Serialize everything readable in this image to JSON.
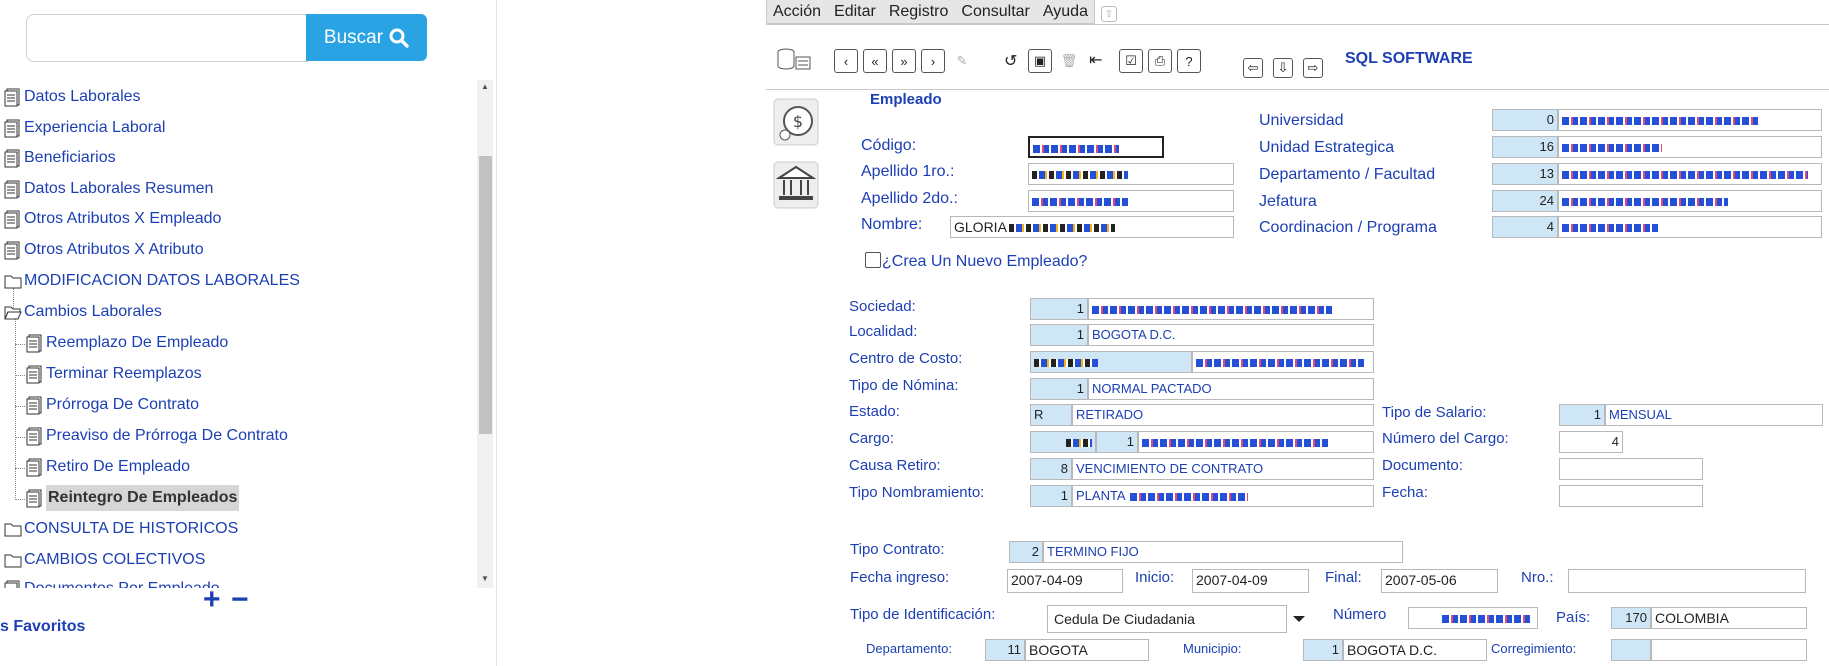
{
  "search": {
    "placeholder": "",
    "button_label": "Buscar"
  },
  "tree": {
    "items": [
      {
        "label": "Datos Laborales"
      },
      {
        "label": "Experiencia Laboral"
      },
      {
        "label": "Beneficiarios"
      },
      {
        "label": "Datos Laborales Resumen"
      },
      {
        "label": "Otros Atributos X Empleado"
      },
      {
        "label": "Otros Atributos X Atributo"
      },
      {
        "label": "MODIFICACION DATOS LABORALES"
      },
      {
        "label": "Cambios Laborales"
      },
      {
        "label": "Reemplazo De Empleado"
      },
      {
        "label": "Terminar Reemplazos"
      },
      {
        "label": "Prórroga De Contrato"
      },
      {
        "label": "Preaviso de Prórroga De Contrato"
      },
      {
        "label": "Retiro De Empleado"
      },
      {
        "label": "Reintegro De Empleados"
      },
      {
        "label": "CONSULTA DE HISTORICOS"
      },
      {
        "label": "CAMBIOS COLECTIVOS"
      },
      {
        "label": "Documentos Por Empleado"
      }
    ],
    "zoom_in": "+",
    "zoom_out": "−",
    "favoritos": "s Favoritos"
  },
  "menu": {
    "items": [
      "Acción",
      "Editar",
      "Registro",
      "Consultar",
      "Ayuda"
    ]
  },
  "toolbar": {
    "brand": "SQL SOFTWARE"
  },
  "empleado": {
    "section_title": "Empleado",
    "codigo_label": "Código:",
    "apellido1_label": "Apellido 1ro.:",
    "apellido2_label": "Apellido 2do.:",
    "nombre_label": "Nombre:",
    "nombre_value": "GLORIA",
    "nuevo_label": "¿Crea Un Nuevo Empleado?"
  },
  "org": {
    "universidad_label": "Universidad",
    "universidad_code": "0",
    "unidad_label": "Unidad Estrategica",
    "unidad_code": "16",
    "departamento_label": "Departamento / Facultad",
    "departamento_code": "13",
    "jefatura_label": "Jefatura",
    "jefatura_code": "24",
    "coordinacion_label": "Coordinacion / Programa",
    "coordinacion_code": "4"
  },
  "laboral": {
    "sociedad_label": "Sociedad:",
    "sociedad_code": "1",
    "localidad_label": "Localidad:",
    "localidad_code": "1",
    "localidad_value": "BOGOTA D.C.",
    "centro_label": "Centro de Costo:",
    "tipo_nomina_label": "Tipo de Nómina:",
    "tipo_nomina_code": "1",
    "tipo_nomina_value": "NORMAL PACTADO",
    "estado_label": "Estado:",
    "estado_code": "R",
    "estado_value": "RETIRADO",
    "cargo_label": "Cargo:",
    "cargo_code2": "1",
    "causa_label": "Causa Retiro:",
    "causa_code": "8",
    "causa_value": "VENCIMIENTO DE CONTRATO",
    "nombramiento_label": "Tipo Nombramiento:",
    "nombramiento_code": "1",
    "nombramiento_value": "PLANTA",
    "tipo_salario_label": "Tipo de Salario:",
    "tipo_salario_code": "1",
    "tipo_salario_value": "MENSUAL",
    "numero_cargo_label": "Número del Cargo:",
    "numero_cargo_value": "4",
    "documento_label": "Documento:",
    "fecha_label": "Fecha:"
  },
  "contrato": {
    "tipo_label": "Tipo Contrato:",
    "tipo_code": "2",
    "tipo_value": "TERMINO FIJO",
    "ingreso_label": "Fecha ingreso:",
    "ingreso_value": "2007-04-09",
    "inicio_label": "Inicio:",
    "inicio_value": "2007-04-09",
    "final_label": "Final:",
    "final_value": "2007-05-06",
    "nro_label": "Nro.:"
  },
  "identificacion": {
    "tipo_label": "Tipo de Identificación:",
    "tipo_value": "Cedula De Ciudadania",
    "numero_label": "Número",
    "pais_label": "País:",
    "pais_code": "170",
    "pais_value": "COLOMBIA",
    "departamento_label": "Departamento:",
    "departamento_code": "11",
    "departamento_value": "BOGOTA",
    "municipio_label": "Municipio:",
    "municipio_code": "1",
    "municipio_value": "BOGOTA D.C.",
    "corregimiento_label": "Corregimiento:"
  }
}
